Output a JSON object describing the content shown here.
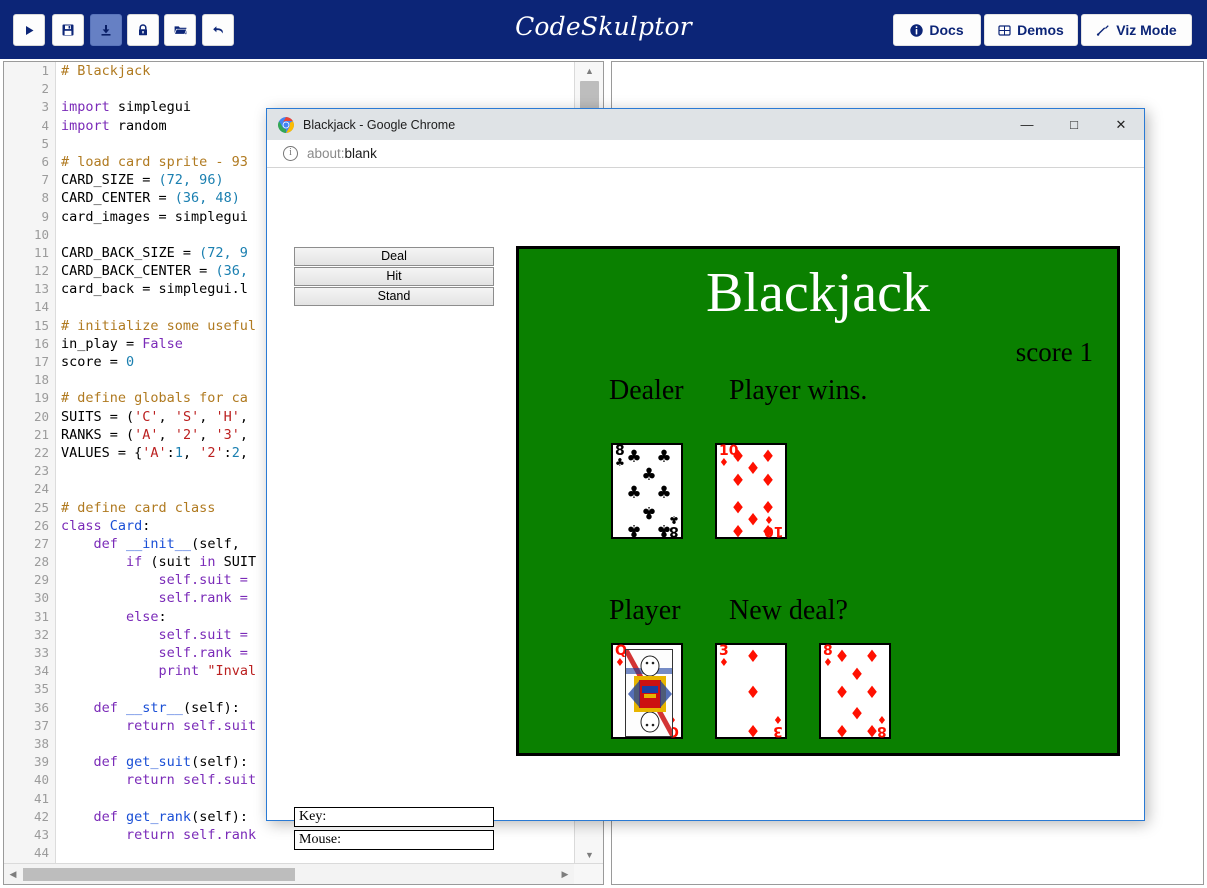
{
  "app": {
    "brand": "CodeSkulptor"
  },
  "toolbar": {
    "left_buttons": [
      {
        "name": "run-button",
        "icon": "play-icon",
        "glyph": "▶",
        "active": false
      },
      {
        "name": "save-button",
        "icon": "save-icon",
        "glyph": "💾",
        "active": false
      },
      {
        "name": "download-button",
        "icon": "download-icon",
        "glyph": "⬇",
        "active": true
      },
      {
        "name": "lock-button",
        "icon": "lock-icon",
        "glyph": "🔒",
        "active": false
      },
      {
        "name": "open-button",
        "icon": "folder-open-icon",
        "glyph": "📂",
        "active": false
      },
      {
        "name": "undo-button",
        "icon": "undo-arrow-icon",
        "glyph": "↶",
        "active": false
      }
    ],
    "right_buttons": [
      {
        "name": "docs-button",
        "label": "Docs",
        "icon": "info-circle-icon",
        "glyph": "ℹ"
      },
      {
        "name": "demos-button",
        "label": "Demos",
        "icon": "demos-icon",
        "glyph": "❐"
      },
      {
        "name": "viz-mode-button",
        "label": "Viz Mode",
        "icon": "wrench-icon",
        "glyph": "⚒"
      }
    ]
  },
  "editor": {
    "first_line_number": 1,
    "last_line_number": 44,
    "lines": [
      {
        "n": 1,
        "tokens": [
          {
            "t": "# Blackjack",
            "c": "tk-com"
          }
        ]
      },
      {
        "n": 2,
        "tokens": []
      },
      {
        "n": 3,
        "tokens": [
          {
            "t": "import ",
            "c": "tk-kw"
          },
          {
            "t": "simplegui",
            "c": "tk-pun"
          }
        ]
      },
      {
        "n": 4,
        "tokens": [
          {
            "t": "import ",
            "c": "tk-kw"
          },
          {
            "t": "random",
            "c": "tk-pun"
          }
        ]
      },
      {
        "n": 5,
        "tokens": []
      },
      {
        "n": 6,
        "tokens": [
          {
            "t": "# load card sprite - 93",
            "c": "tk-com"
          }
        ]
      },
      {
        "n": 7,
        "tokens": [
          {
            "t": "CARD_SIZE = ",
            "c": "tk-pun"
          },
          {
            "t": "(72, 96)",
            "c": "tk-num"
          }
        ]
      },
      {
        "n": 8,
        "tokens": [
          {
            "t": "CARD_CENTER = ",
            "c": "tk-pun"
          },
          {
            "t": "(36, 48)",
            "c": "tk-num"
          }
        ]
      },
      {
        "n": 9,
        "tokens": [
          {
            "t": "card_images = simplegui",
            "c": "tk-pun"
          }
        ]
      },
      {
        "n": 10,
        "tokens": []
      },
      {
        "n": 11,
        "tokens": [
          {
            "t": "CARD_BACK_SIZE = ",
            "c": "tk-pun"
          },
          {
            "t": "(72, 9",
            "c": "tk-num"
          }
        ]
      },
      {
        "n": 12,
        "tokens": [
          {
            "t": "CARD_BACK_CENTER = ",
            "c": "tk-pun"
          },
          {
            "t": "(36,",
            "c": "tk-num"
          }
        ]
      },
      {
        "n": 13,
        "tokens": [
          {
            "t": "card_back = simplegui.l",
            "c": "tk-pun"
          }
        ]
      },
      {
        "n": 14,
        "tokens": []
      },
      {
        "n": 15,
        "tokens": [
          {
            "t": "# initialize some useful",
            "c": "tk-com"
          }
        ]
      },
      {
        "n": 16,
        "tokens": [
          {
            "t": "in_play = ",
            "c": "tk-pun"
          },
          {
            "t": "False",
            "c": "tk-kw"
          }
        ]
      },
      {
        "n": 17,
        "tokens": [
          {
            "t": "score = ",
            "c": "tk-pun"
          },
          {
            "t": "0",
            "c": "tk-num"
          }
        ]
      },
      {
        "n": 18,
        "tokens": []
      },
      {
        "n": 19,
        "tokens": [
          {
            "t": "# define globals for ca",
            "c": "tk-com"
          }
        ]
      },
      {
        "n": 20,
        "tokens": [
          {
            "t": "SUITS = (",
            "c": "tk-pun"
          },
          {
            "t": "'C'",
            "c": "tk-str"
          },
          {
            "t": ", ",
            "c": "tk-pun"
          },
          {
            "t": "'S'",
            "c": "tk-str"
          },
          {
            "t": ", ",
            "c": "tk-pun"
          },
          {
            "t": "'H'",
            "c": "tk-str"
          },
          {
            "t": ",",
            "c": "tk-pun"
          }
        ]
      },
      {
        "n": 21,
        "tokens": [
          {
            "t": "RANKS = (",
            "c": "tk-pun"
          },
          {
            "t": "'A'",
            "c": "tk-str"
          },
          {
            "t": ", ",
            "c": "tk-pun"
          },
          {
            "t": "'2'",
            "c": "tk-str"
          },
          {
            "t": ", ",
            "c": "tk-pun"
          },
          {
            "t": "'3'",
            "c": "tk-str"
          },
          {
            "t": ",",
            "c": "tk-pun"
          }
        ]
      },
      {
        "n": 22,
        "tokens": [
          {
            "t": "VALUES = {",
            "c": "tk-pun"
          },
          {
            "t": "'A'",
            "c": "tk-str"
          },
          {
            "t": ":",
            "c": "tk-pun"
          },
          {
            "t": "1",
            "c": "tk-num"
          },
          {
            "t": ", ",
            "c": "tk-pun"
          },
          {
            "t": "'2'",
            "c": "tk-str"
          },
          {
            "t": ":",
            "c": "tk-pun"
          },
          {
            "t": "2",
            "c": "tk-num"
          },
          {
            "t": ",",
            "c": "tk-pun"
          }
        ]
      },
      {
        "n": 23,
        "tokens": []
      },
      {
        "n": 24,
        "tokens": []
      },
      {
        "n": 25,
        "tokens": [
          {
            "t": "# define card class",
            "c": "tk-com"
          }
        ]
      },
      {
        "n": 26,
        "tokens": [
          {
            "t": "class ",
            "c": "tk-kw"
          },
          {
            "t": "Card",
            "c": "tk-def"
          },
          {
            "t": ":",
            "c": "tk-pun"
          }
        ]
      },
      {
        "n": 27,
        "tokens": [
          {
            "t": "    ",
            "c": "tk-pun"
          },
          {
            "t": "def ",
            "c": "tk-kw"
          },
          {
            "t": "__init__",
            "c": "tk-def"
          },
          {
            "t": "(self, ",
            "c": "tk-pun"
          }
        ]
      },
      {
        "n": 28,
        "tokens": [
          {
            "t": "        ",
            "c": "tk-pun"
          },
          {
            "t": "if ",
            "c": "tk-kw"
          },
          {
            "t": "(suit ",
            "c": "tk-pun"
          },
          {
            "t": "in ",
            "c": "tk-kw"
          },
          {
            "t": "SUIT",
            "c": "tk-pun"
          }
        ]
      },
      {
        "n": 29,
        "tokens": [
          {
            "t": "            self.suit = ",
            "c": "tk-fn"
          }
        ]
      },
      {
        "n": 30,
        "tokens": [
          {
            "t": "            self.rank = ",
            "c": "tk-fn"
          }
        ]
      },
      {
        "n": 31,
        "tokens": [
          {
            "t": "        ",
            "c": "tk-pun"
          },
          {
            "t": "else",
            "c": "tk-kw"
          },
          {
            "t": ":",
            "c": "tk-pun"
          }
        ]
      },
      {
        "n": 32,
        "tokens": [
          {
            "t": "            self.suit = ",
            "c": "tk-fn"
          }
        ]
      },
      {
        "n": 33,
        "tokens": [
          {
            "t": "            self.rank = ",
            "c": "tk-fn"
          }
        ]
      },
      {
        "n": 34,
        "tokens": [
          {
            "t": "            ",
            "c": "tk-pun"
          },
          {
            "t": "print ",
            "c": "tk-kw"
          },
          {
            "t": "\"Inval",
            "c": "tk-str"
          }
        ]
      },
      {
        "n": 35,
        "tokens": []
      },
      {
        "n": 36,
        "tokens": [
          {
            "t": "    ",
            "c": "tk-pun"
          },
          {
            "t": "def ",
            "c": "tk-kw"
          },
          {
            "t": "__str__",
            "c": "tk-def"
          },
          {
            "t": "(self):",
            "c": "tk-pun"
          }
        ]
      },
      {
        "n": 37,
        "tokens": [
          {
            "t": "        ",
            "c": "tk-pun"
          },
          {
            "t": "return ",
            "c": "tk-kw"
          },
          {
            "t": "self.suit",
            "c": "tk-fn"
          }
        ]
      },
      {
        "n": 38,
        "tokens": []
      },
      {
        "n": 39,
        "tokens": [
          {
            "t": "    ",
            "c": "tk-pun"
          },
          {
            "t": "def ",
            "c": "tk-kw"
          },
          {
            "t": "get_suit",
            "c": "tk-def"
          },
          {
            "t": "(self):",
            "c": "tk-pun"
          }
        ]
      },
      {
        "n": 40,
        "tokens": [
          {
            "t": "        ",
            "c": "tk-pun"
          },
          {
            "t": "return ",
            "c": "tk-kw"
          },
          {
            "t": "self.suit",
            "c": "tk-fn"
          }
        ]
      },
      {
        "n": 41,
        "tokens": []
      },
      {
        "n": 42,
        "tokens": [
          {
            "t": "    ",
            "c": "tk-pun"
          },
          {
            "t": "def ",
            "c": "tk-kw"
          },
          {
            "t": "get_rank",
            "c": "tk-def"
          },
          {
            "t": "(self):",
            "c": "tk-pun"
          }
        ]
      },
      {
        "n": 43,
        "tokens": [
          {
            "t": "        ",
            "c": "tk-pun"
          },
          {
            "t": "return ",
            "c": "tk-kw"
          },
          {
            "t": "self.rank",
            "c": "tk-fn"
          }
        ]
      },
      {
        "n": 44,
        "tokens": []
      }
    ]
  },
  "browser": {
    "window_title": "Blackjack - Google Chrome",
    "url_scheme": "about:",
    "url_host": "blank",
    "window_controls": [
      {
        "name": "minimize-button",
        "glyph": "—"
      },
      {
        "name": "maximize-button",
        "glyph": "□"
      },
      {
        "name": "close-button",
        "glyph": "✕"
      }
    ]
  },
  "game": {
    "controls": [
      {
        "name": "deal-button",
        "label": "Deal"
      },
      {
        "name": "hit-button",
        "label": "Hit"
      },
      {
        "name": "stand-button",
        "label": "Stand"
      }
    ],
    "inputs": [
      {
        "name": "key-input",
        "label": "Key:",
        "value": ""
      },
      {
        "name": "mouse-input",
        "label": "Mouse:",
        "value": ""
      }
    ],
    "canvas": {
      "background_color": "#0a8000",
      "title": "Blackjack",
      "title_color": "#ffffff",
      "score_text": "score 1",
      "dealer_label": "Dealer",
      "dealer_message": "Player wins.",
      "player_label": "Player",
      "player_message": "New deal?",
      "dealer_cards": [
        {
          "rank": "8",
          "suit": "clubs",
          "symbol": "♣",
          "color": "#000000",
          "pips": 8
        },
        {
          "rank": "10",
          "suit": "diamonds",
          "symbol": "♦",
          "color": "#ff1000",
          "pips": 10
        }
      ],
      "player_cards": [
        {
          "rank": "Q",
          "suit": "diamonds",
          "symbol": "♦",
          "color": "#ff1000",
          "pips": 0
        },
        {
          "rank": "3",
          "suit": "diamonds",
          "symbol": "♦",
          "color": "#ff1000",
          "pips": 3
        },
        {
          "rank": "8",
          "suit": "diamonds",
          "symbol": "♦",
          "color": "#ff1000",
          "pips": 8
        }
      ]
    }
  }
}
